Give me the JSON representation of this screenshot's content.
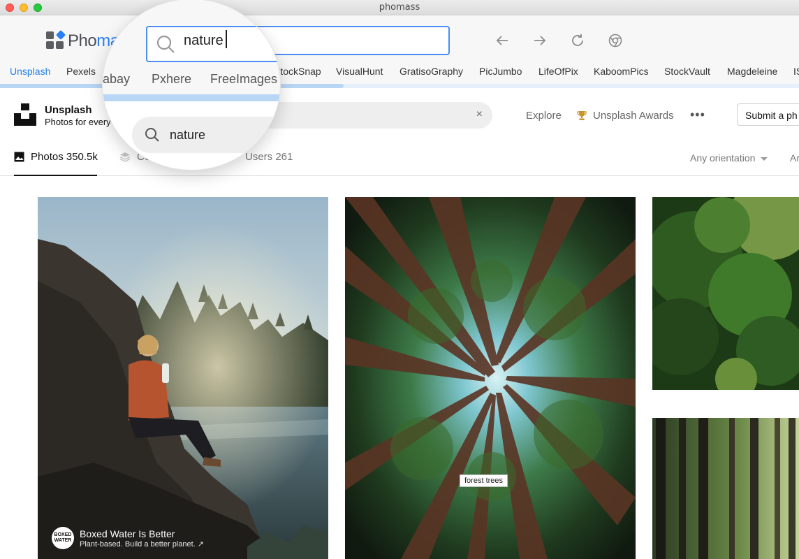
{
  "window": {
    "title": "phomass"
  },
  "app": {
    "brand_prefix": "Pho",
    "brand_visible_suffix": "ma",
    "search": {
      "value": "nature",
      "placeholder": ""
    }
  },
  "sources": {
    "tabs": [
      "Unsplash",
      "Pexels",
      "abay",
      "Pxhere",
      "FreeImages",
      "StockSnap",
      "VisualHunt",
      "GratisoGraphy",
      "PicJumbo",
      "LifeOfPix",
      "KaboomPics",
      "StockVault",
      "Magdeleine",
      "IS"
    ],
    "active": "Unsplash",
    "load_progress": 0.43
  },
  "unsplash": {
    "brand": "Unsplash",
    "tagline": "Photos for every",
    "search_value": "nature",
    "clear_label": "×",
    "nav": {
      "explore": "Explore",
      "awards": "Unsplash Awards",
      "more": "•••"
    },
    "submit_label": "Submit a ph"
  },
  "filters": {
    "photos": "Photos 350.5k",
    "collections": "Co",
    "users": "Users 261",
    "orientation": "Any orientation",
    "extra": "Ar"
  },
  "photos": {
    "p1_alt": "Woman sitting on rocks by a river at sunset",
    "sponsor": {
      "logo_text": "BOXED WATER",
      "name": "Boxed Water Is Better",
      "tagline": "Plant-based. Build a better planet. ↗"
    },
    "p2_tooltip": "forest trees"
  },
  "magnifier": {
    "query": "nature",
    "tabs": [
      "abay",
      "Pxhere",
      "FreeImages"
    ],
    "unsplash_query": "nature"
  }
}
